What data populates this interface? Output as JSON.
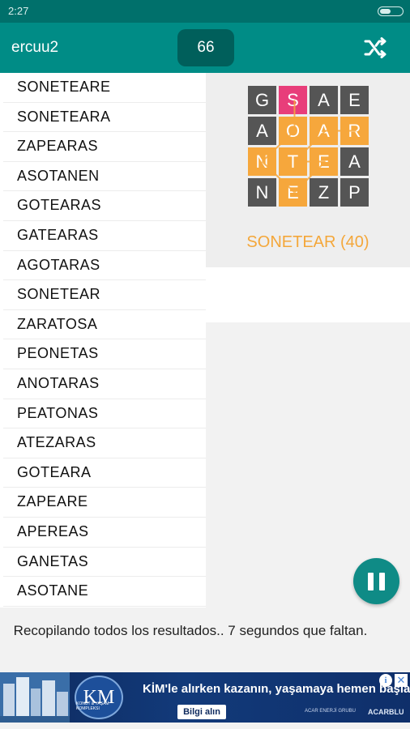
{
  "status_bar": {
    "time": "2:27"
  },
  "header": {
    "username": "ercuu2",
    "score": "66",
    "shuffle_icon": "shuffle-icon"
  },
  "words": [
    "SONETEARE",
    "SONETEARA",
    "ZAPEARAS",
    "ASOTANEN",
    "GOTEARAS",
    "GATEARAS",
    "AGOTARAS",
    "SONETEAR",
    "ZARATOSA",
    "PEONETAS",
    "ANOTARAS",
    "PEATONAS",
    "ATEZARAS",
    "GOTEARA",
    "ZAPEARE",
    "APEREAS",
    "GANETAS",
    "ASOTANE"
  ],
  "board": {
    "rows": [
      [
        "G",
        "S",
        "A",
        "E"
      ],
      [
        "A",
        "O",
        "A",
        "R"
      ],
      [
        "N",
        "T",
        "E",
        "A"
      ],
      [
        "N",
        "E",
        "Z",
        "P"
      ]
    ],
    "tile_states": [
      [
        "dark",
        "pink",
        "dark",
        "dark"
      ],
      [
        "dark",
        "orange",
        "orange",
        "orange"
      ],
      [
        "orange",
        "orange",
        "orange",
        "dark"
      ],
      [
        "dark",
        "orange",
        "dark",
        "dark"
      ]
    ],
    "colors": {
      "dark": "#555555",
      "pink": "#e83e7a",
      "orange": "#f6a73c",
      "teal": "#008c86"
    },
    "found_word": "SONETEAR (40)"
  },
  "pause_icon": "pause-icon",
  "message": "Recopilando todos los resultados.. 7 segundos que faltan.",
  "ad": {
    "logo_text": "KM",
    "logo_subtext": "KONUT & YAŞAM KOMPLEKSI",
    "headline": "KİM'le alırken kazanın, yaşamaya hemen başlayın",
    "cta": "Bilgi alın",
    "partner": "ACAR ENERJİ GRUBU",
    "brand": "ACARBLU"
  }
}
